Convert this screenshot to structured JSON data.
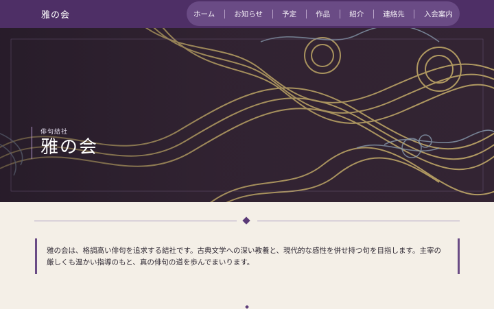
{
  "header": {
    "site_title": "雅の会",
    "nav": [
      "ホーム",
      "お知らせ",
      "予定",
      "作品",
      "紹介",
      "連絡先",
      "入会案内"
    ]
  },
  "hero": {
    "kicker": "俳句結社",
    "heading": "雅の会"
  },
  "intro": {
    "text": "雅の会は、格調高い俳句を追求する結社です。古典文学への深い教養と、現代的な感性を併せ持つ句を目指します。主宰の厳しくも温かい指導のもと、真の俳句の道を歩んでまいります。"
  },
  "colors": {
    "header": "#4e2f66",
    "accent": "#6a4b85",
    "background": "#f4efe7",
    "pattern_gold": "#c9b06b",
    "pattern_blue": "#8fa4b8"
  }
}
